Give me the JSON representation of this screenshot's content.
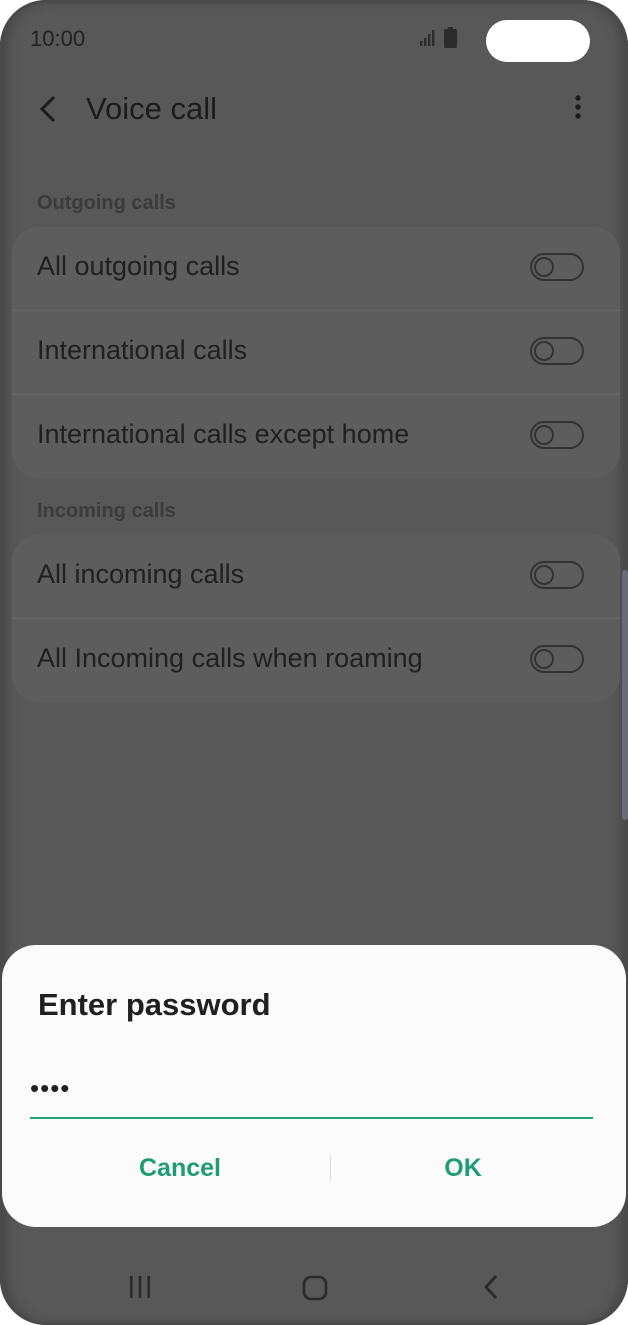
{
  "status_bar": {
    "time": "10:00"
  },
  "app_bar": {
    "title": "Voice call"
  },
  "outgoing": {
    "section_label": "Outgoing calls",
    "items": [
      {
        "label": "All outgoing calls",
        "enabled": false
      },
      {
        "label": "International calls",
        "enabled": false
      },
      {
        "label": "International calls except home",
        "enabled": false
      }
    ]
  },
  "incoming": {
    "section_label": "Incoming calls",
    "items": [
      {
        "label": "All incoming calls",
        "enabled": false
      },
      {
        "label": "All Incoming calls when roaming",
        "enabled": false
      }
    ]
  },
  "dialog": {
    "title": "Enter password",
    "password_value": "••••",
    "cancel_label": "Cancel",
    "ok_label": "OK"
  },
  "colors": {
    "accent": "#1f9c74",
    "underline": "#25a080",
    "dim_background": "#585858",
    "dialog_background": "#fbfbfb"
  },
  "icons": {
    "back": "chevron-left-icon",
    "more": "more-vertical-icon",
    "signal": "signal-icon",
    "battery": "battery-icon",
    "recent": "recent-apps-icon",
    "home": "home-icon",
    "nav_back": "nav-back-icon"
  }
}
